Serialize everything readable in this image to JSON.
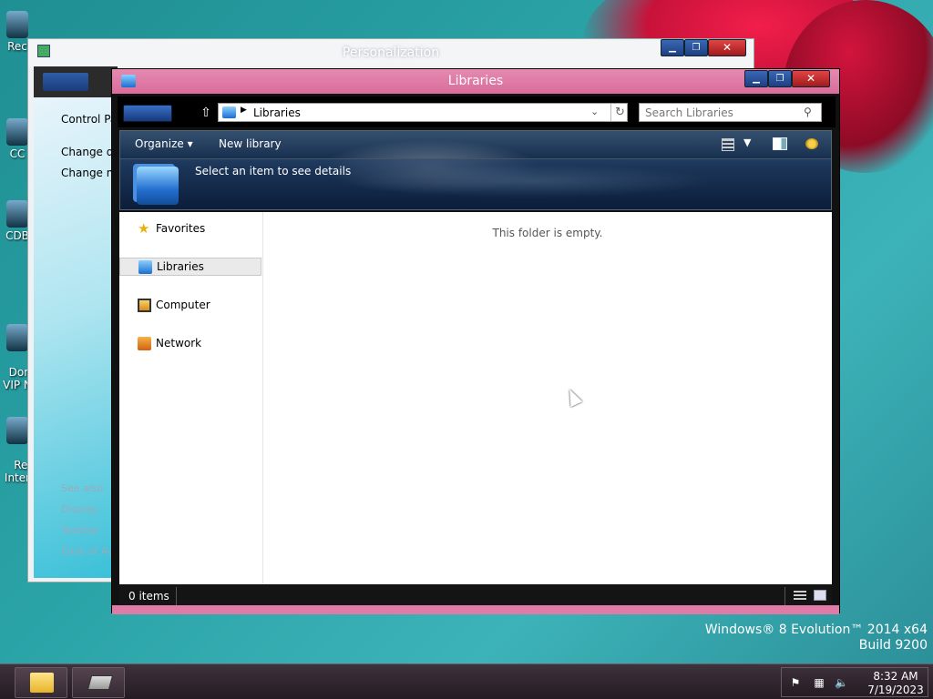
{
  "desktop": {
    "icons": [
      {
        "label": "Rec",
        "name": "recycle-bin"
      },
      {
        "label": "CC",
        "name": "cc-cleaner"
      },
      {
        "label": "CDB",
        "name": "cdburner"
      },
      {
        "label": "Dona\nVIP N",
        "name": "donate-vip"
      },
      {
        "label": "Re\nInter",
        "name": "reset-internet"
      }
    ],
    "watermark_line1": "Windows® 8 Evolution™ 2014 x64",
    "watermark_line2": "Build 9200"
  },
  "personalization": {
    "title": "Personalization",
    "links": [
      "Control Pa",
      "Change de",
      "Change m"
    ],
    "see_also": "See also",
    "see_also_links": [
      "Display",
      "Taskbar",
      "Ease of Ac"
    ]
  },
  "libraries_window": {
    "title": "Libraries",
    "address": "Libraries",
    "search_placeholder": "Search Libraries",
    "toolbar": {
      "organize": "Organize",
      "new_library": "New library"
    },
    "details_text": "Select an item to see details",
    "nav": {
      "favorites": "Favorites",
      "libraries": "Libraries",
      "computer": "Computer",
      "network": "Network"
    },
    "empty_message": "This folder is empty.",
    "status_count": "0 items"
  },
  "taskbar": {
    "time": "8:32 AM",
    "date": "7/19/2023"
  }
}
